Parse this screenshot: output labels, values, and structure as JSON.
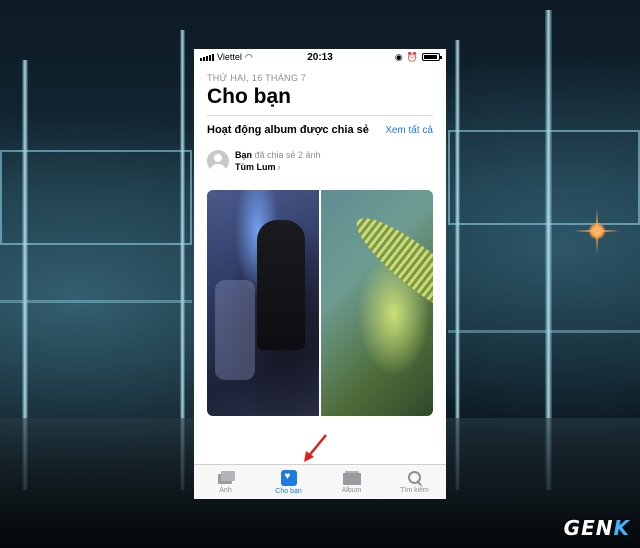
{
  "status_bar": {
    "carrier": "Viettel",
    "time": "20:13",
    "battery_level": 0.9
  },
  "header": {
    "date": "THỨ HAI, 16 THÁNG 7",
    "title": "Cho bạn"
  },
  "shared_album_activity": {
    "section_title": "Hoạt động album được chia sẻ",
    "see_all": "Xem tất cả",
    "user": "Bạn",
    "action": "đã chia sẻ 2 ảnh",
    "album_name": "Tùm Lum",
    "chevron": "›"
  },
  "tab_bar": {
    "tabs": [
      {
        "label": "Ảnh",
        "icon": "photos-icon",
        "active": false
      },
      {
        "label": "Cho bạn",
        "icon": "for-you-icon",
        "active": true
      },
      {
        "label": "Album",
        "icon": "album-icon",
        "active": false
      },
      {
        "label": "Tìm kiếm",
        "icon": "search-icon",
        "active": false
      }
    ]
  },
  "colors": {
    "accent": "#1f7ae0",
    "annotation_arrow": "#e0201a"
  },
  "watermark": {
    "prefix": "GEN",
    "suffix": "K"
  }
}
